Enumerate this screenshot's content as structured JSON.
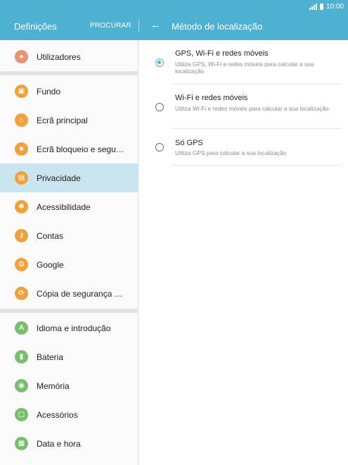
{
  "status_bar": {
    "time": "10:00"
  },
  "header": {
    "left_title": "Definições",
    "search_label": "PROCURAR",
    "back_icon": "←",
    "right_title": "Método de localização"
  },
  "sidebar": {
    "items": [
      {
        "label": "Utilizadores",
        "icon": "users-icon",
        "color": "#eb9176",
        "glyph": "👥"
      },
      {
        "label": "Fundo",
        "icon": "wallpaper-icon",
        "color": "#f1a13a",
        "glyph": "▣"
      },
      {
        "label": "Ecrã principal",
        "icon": "home-icon",
        "color": "#f1a13a",
        "glyph": "⌂"
      },
      {
        "label": "Ecrã bloqueio e segurança",
        "icon": "lock-icon",
        "color": "#f1a13a",
        "glyph": "🔒"
      },
      {
        "label": "Privacidade",
        "icon": "privacy-icon",
        "color": "#f1a13a",
        "glyph": "▤",
        "active": true
      },
      {
        "label": "Acessibilidade",
        "icon": "accessibility-icon",
        "color": "#f1a13a",
        "glyph": "✱"
      },
      {
        "label": "Contas",
        "icon": "key-icon",
        "color": "#f1a13a",
        "glyph": "⚷"
      },
      {
        "label": "Google",
        "icon": "google-icon",
        "color": "#f1a13a",
        "glyph": "G"
      },
      {
        "label": "Cópia de segurança e restauro",
        "icon": "backup-icon",
        "color": "#f1a13a",
        "glyph": "⟳"
      },
      {
        "label": "Idioma e introdução",
        "icon": "language-icon",
        "color": "#79be6d",
        "glyph": "A"
      },
      {
        "label": "Bateria",
        "icon": "battery-icon",
        "color": "#79be6d",
        "glyph": "▮"
      },
      {
        "label": "Memória",
        "icon": "storage-icon",
        "color": "#79be6d",
        "glyph": "◉"
      },
      {
        "label": "Acessórios",
        "icon": "accessories-icon",
        "color": "#79be6d",
        "glyph": "▢"
      },
      {
        "label": "Data e hora",
        "icon": "calendar-icon",
        "color": "#79be6d",
        "glyph": "▦"
      }
    ]
  },
  "options": [
    {
      "title": "GPS, Wi-Fi e redes móveis",
      "description": "Utiliza GPS, Wi-Fi e redes móveis para calcular a sua localização",
      "selected": true
    },
    {
      "title": "Wi-Fi e redes móveis",
      "description": "Utiliza Wi-Fi e redes móveis para calcular a sua localização",
      "selected": false
    },
    {
      "title": "Só GPS",
      "description": "Utiliza GPS para calcular a sua localização",
      "selected": false
    }
  ],
  "colors": {
    "accent": "#4fb1d2",
    "active_row": "#c9e5ef"
  }
}
